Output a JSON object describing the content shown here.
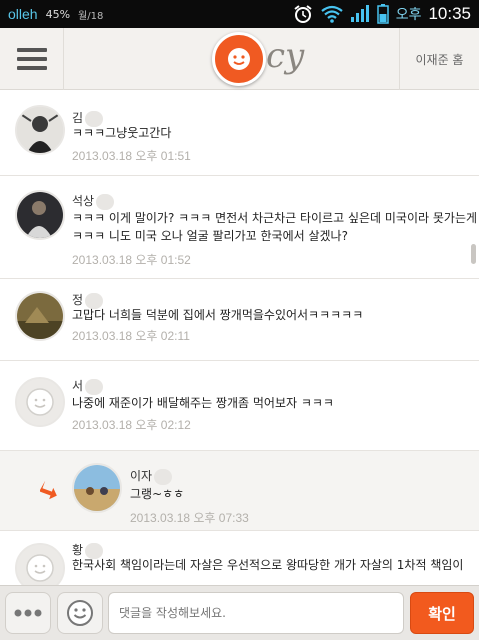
{
  "status_bar": {
    "carrier": "olleh",
    "battery_percent": "45%",
    "small_text": "월/18",
    "ampm": "오후",
    "time": "10:35"
  },
  "header": {
    "logo_script": "cy",
    "home_label": "이재준 홈"
  },
  "posts": [
    {
      "name": "김",
      "text": "ㅋㅋㅋ그냥웃고간다",
      "time": "2013.03.18 오후 01:51"
    },
    {
      "name": "석상",
      "text": "ㅋㅋㅋ 이게 말이가? ㅋㅋㅋ 면전서 차근차근 타이르고 싶은데 미국이라 못가는게 함정",
      "text2": "ㅋㅋㅋ 니도 미국 오나 얼굴 팔리가꼬 한국에서 살겠나?",
      "time": "2013.03.18 오후 01:52"
    },
    {
      "name": "정",
      "text": "고맙다 너희들 덕분에   집에서 짱개먹을수있어서ㅋㅋㅋㅋㅋ",
      "time": "2013.03.18 오후 02:11"
    },
    {
      "name": "서",
      "text": "나중에 재준이가 배달해주는 짱개좀 먹어보자 ㅋㅋㅋ",
      "time": "2013.03.18 오후 02:12"
    },
    {
      "name": "이자",
      "text": "그랭~ㅎㅎ",
      "time": "2013.03.18 오후 07:33"
    },
    {
      "name": "황",
      "text": "한국사회 책임이라는데 자살은 우선적으로 왕따당한 개가 자살의 1차적 책임이"
    }
  ],
  "comment_input": {
    "placeholder": "댓글을 작성해보세요."
  },
  "confirm_button": {
    "label": "확인"
  },
  "icons": {
    "menu": "hamburger-icon",
    "logo": "cy-logo-icon",
    "reply_arrow": "reply-arrow-icon",
    "more": "more-dots-icon",
    "emoticon": "smiley-icon"
  },
  "colors": {
    "accent": "#f05a22",
    "time_text": "#b3b0ab"
  }
}
